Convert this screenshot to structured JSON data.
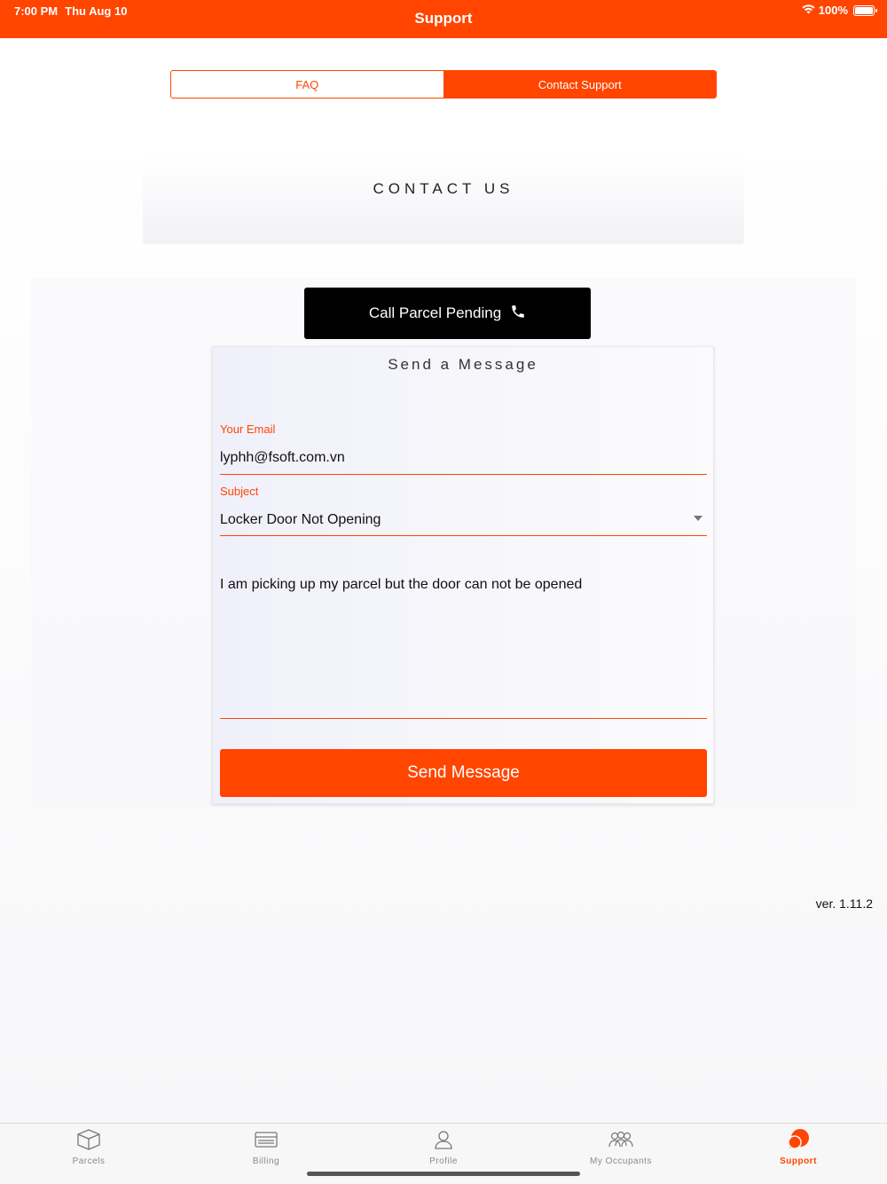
{
  "status_bar": {
    "time": "7:00 PM",
    "date": "Thu Aug 10",
    "battery": "100%"
  },
  "header": {
    "title": "Support",
    "accent_color": "#ff4500"
  },
  "segments": {
    "faq": "FAQ",
    "contact": "Contact Support",
    "active": "contact"
  },
  "contact": {
    "title": "CONTACT US"
  },
  "call_button": {
    "label": "Call Parcel Pending",
    "icon": "phone-icon"
  },
  "message_form": {
    "title": "Send a Message",
    "email_label": "Your Email",
    "email_value": "lyphh@fsoft.com.vn",
    "subject_label": "Subject",
    "subject_value": "Locker Door Not Opening",
    "message_value": "I am picking up my parcel but the door can not be opened",
    "send_label": "Send Message"
  },
  "version": "ver. 1.11.2",
  "tabs": [
    {
      "label": "Parcels",
      "icon": "box-icon"
    },
    {
      "label": "Billing",
      "icon": "billing-icon"
    },
    {
      "label": "Profile",
      "icon": "profile-icon"
    },
    {
      "label": "My Occupants",
      "icon": "occupants-icon"
    },
    {
      "label": "Support",
      "icon": "support-chat-icon",
      "active": true
    }
  ]
}
